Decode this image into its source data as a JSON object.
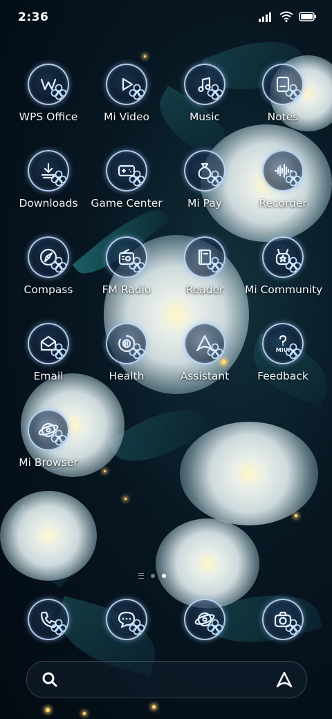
{
  "status": {
    "time": "2:36",
    "icons": [
      "signal-icon",
      "wifi-icon",
      "battery-icon"
    ]
  },
  "apps": [
    {
      "label": "WPS Office",
      "icon": "wps-office-icon"
    },
    {
      "label": "Mi Video",
      "icon": "play-icon"
    },
    {
      "label": "Music",
      "icon": "music-note-icon"
    },
    {
      "label": "Notes",
      "icon": "notes-icon"
    },
    {
      "label": "Downloads",
      "icon": "download-icon"
    },
    {
      "label": "Game Center",
      "icon": "gamepad-icon"
    },
    {
      "label": "Mi Pay",
      "icon": "money-bag-icon"
    },
    {
      "label": "Recorder",
      "icon": "waveform-icon"
    },
    {
      "label": "Compass",
      "icon": "compass-icon"
    },
    {
      "label": "FM Radio",
      "icon": "radio-icon"
    },
    {
      "label": "Reader",
      "icon": "book-icon"
    },
    {
      "label": "Mi Community",
      "icon": "community-icon"
    },
    {
      "label": "Email",
      "icon": "envelope-icon"
    },
    {
      "label": "Health",
      "icon": "health-icon"
    },
    {
      "label": "Assistant",
      "icon": "assistant-icon"
    },
    {
      "label": "Feedback",
      "icon": "feedback-icon"
    },
    {
      "label": "Mi Browser",
      "icon": "browser-icon"
    }
  ],
  "dock": [
    {
      "icon": "phone-icon"
    },
    {
      "icon": "messages-icon"
    },
    {
      "icon": "browser-icon"
    },
    {
      "icon": "camera-icon"
    }
  ],
  "page_indicator": {
    "pages": 2,
    "active": 2
  },
  "search_bar": {
    "left_icon": "search-icon",
    "right_icon": "assistant-icon"
  },
  "theme": {
    "accent": "#cfe4ff",
    "glow": "#8cbcff"
  }
}
